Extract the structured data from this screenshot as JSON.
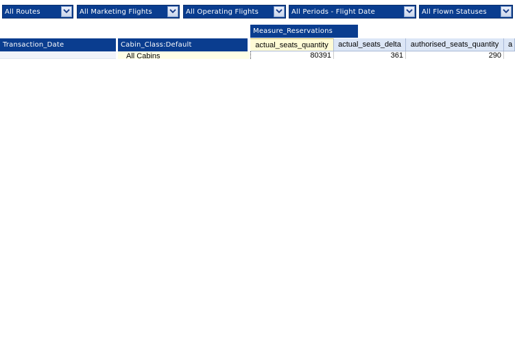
{
  "filters": [
    {
      "label": "All Routes"
    },
    {
      "label": "All Marketing Flights"
    },
    {
      "label": "All Operating Flights"
    },
    {
      "label": "All Periods - Flight Date"
    },
    {
      "label": "All Flown Statuses"
    }
  ],
  "pivot": {
    "measure_header": "Measure_Reservations",
    "row_headers": {
      "transaction_date": "Transaction_Date",
      "cabin_class": "Cabin_Class:Default"
    },
    "columns": [
      {
        "label": "actual_seats_quantity"
      },
      {
        "label": "actual_seats_delta"
      },
      {
        "label": "authorised_seats_quantity"
      },
      {
        "label": "a"
      }
    ],
    "rows": [
      {
        "cabin": "All Cabins",
        "values": [
          "80391",
          "361",
          "290"
        ]
      }
    ]
  },
  "colors": {
    "header_blue": "#0a3d8f",
    "column_header_bg": "#dce6f6",
    "selected_column_bg": "#fffbd6"
  },
  "icons": {
    "dropdown": "chevron-down-icon"
  }
}
